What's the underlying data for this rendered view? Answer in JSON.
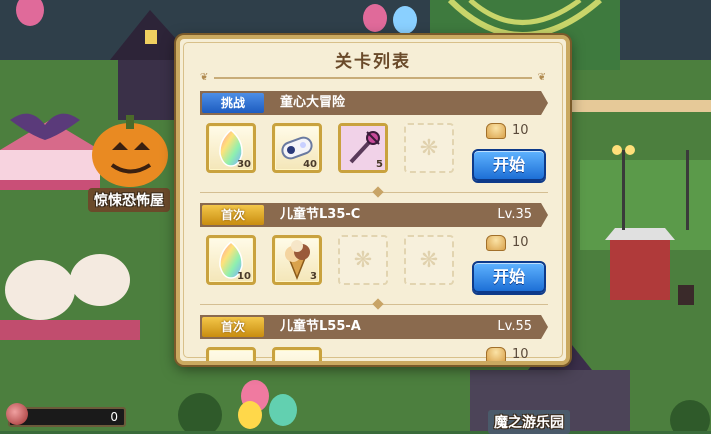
{
  "background": {
    "horror_house_label": "惊悚恐怖屋",
    "magic_park_label": "魔之游乐园",
    "score_value": "0"
  },
  "panel": {
    "title": "关卡列表"
  },
  "stages": [
    {
      "tag": "挑战",
      "tag_style": "blue",
      "name": "童心大冒险",
      "level": "",
      "rewards": [
        {
          "icon": "rainbow-gem-icon",
          "count": "30"
        },
        {
          "icon": "star-charm-icon",
          "count": "40"
        },
        {
          "icon": "staff-weapon-icon",
          "count": "5"
        },
        {
          "icon": "empty-slot-icon",
          "count": ""
        }
      ],
      "cost": "10",
      "cost_icon": "bread-icon",
      "button": "开始"
    },
    {
      "tag": "首次",
      "tag_style": "gold",
      "name": "儿童节L35-C",
      "level": "Lv.35",
      "rewards": [
        {
          "icon": "rainbow-gem-icon",
          "count": "10"
        },
        {
          "icon": "ice-cream-icon",
          "count": "3"
        },
        {
          "icon": "empty-slot-icon",
          "count": ""
        },
        {
          "icon": "empty-slot-icon",
          "count": ""
        }
      ],
      "cost": "10",
      "cost_icon": "bread-icon",
      "button": "开始"
    },
    {
      "tag": "首次",
      "tag_style": "gold",
      "name": "儿童节L55-A",
      "level": "Lv.55",
      "rewards": [],
      "cost": "10",
      "cost_icon": "bread-icon",
      "button": ""
    }
  ],
  "colors": {
    "panel_bg": "#f6eed6",
    "panel_border": "#caa960",
    "header_bar": "#8a6a4e",
    "tag_blue": "#1d5cc0",
    "tag_gold": "#c98d10",
    "start_button": "#1d6fd6"
  }
}
